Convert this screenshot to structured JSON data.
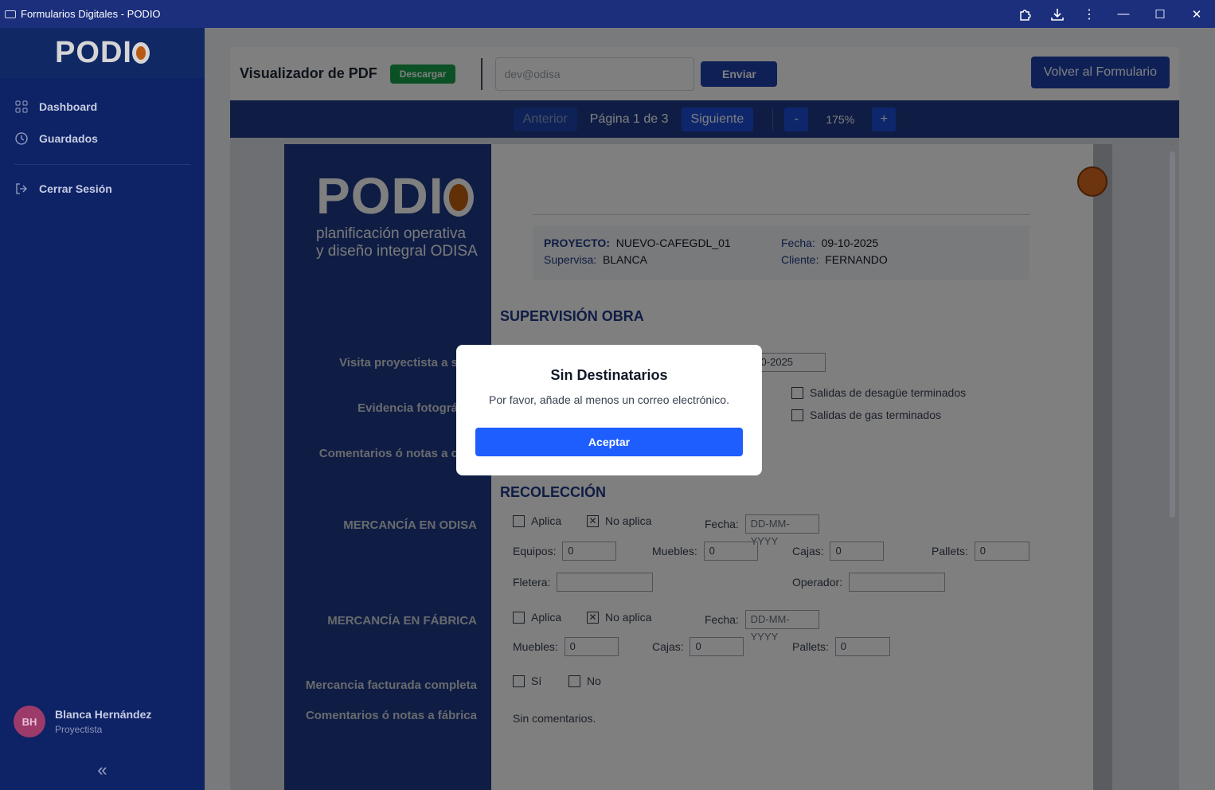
{
  "window": {
    "title": "Formularios Digitales - PODIO"
  },
  "sidebar": {
    "logo": "PODI",
    "items": [
      {
        "label": "Dashboard",
        "icon": "grid-icon"
      },
      {
        "label": "Guardados",
        "icon": "clock-icon"
      }
    ],
    "logout": {
      "label": "Cerrar Sesión",
      "icon": "logout-icon"
    },
    "user": {
      "initials": "BH",
      "name": "Blanca Hernández",
      "role": "Proyectista"
    }
  },
  "toolbar": {
    "title": "Visualizador de PDF",
    "download": "Descargar",
    "email_placeholder": "dev@odisa",
    "send": "Enviar",
    "back": "Volver al Formulario"
  },
  "pager": {
    "prev": "Anterior",
    "label": "Página 1 de 3",
    "next": "Siguiente",
    "zoom_out": "-",
    "zoom": "175%",
    "zoom_in": "+"
  },
  "doc": {
    "logo": "PODI",
    "logo_sub1": "planificación operativa",
    "logo_sub2": "y diseño integral ODISA",
    "info": {
      "proyecto_k": "PROYECTO:",
      "proyecto_v": "NUEVO-CAFEGDL_01",
      "fecha_k": "Fecha:",
      "fecha_v": "09-10-2025",
      "supervisa_k": "Supervisa:",
      "supervisa_v": "BLANCA",
      "cliente_k": "Cliente:",
      "cliente_v": "FERNANDO"
    },
    "sec1": "SUPERVISIÓN OBRA",
    "labels": {
      "visita": "Visita proyectista a s",
      "evidencia": "Evidencia fotográ",
      "comentarios": "Comentarios ó notas a c",
      "merc_odisa": "MERCANCÍA EN ODISA",
      "merc_fabrica": "MERCANCÍA EN FÁBRICA",
      "facturada": "Mercancia facturada completa",
      "com_fabrica": "Comentarios ó notas a fábrica"
    },
    "visita_fecha": "-10-2025",
    "salidas_desague": "Salidas de desagüe terminados",
    "salidas_gas": "Salidas de gas terminados",
    "sec2": "RECOLECCIÓN",
    "aplica": "Aplica",
    "no_aplica": "No aplica",
    "fecha_lbl": "Fecha:",
    "fecha_ph": "DD-MM-YYYY",
    "equipos_lbl": "Equipos:",
    "equipos": "0",
    "muebles_lbl": "Muebles:",
    "muebles": "0",
    "cajas_lbl": "Cajas:",
    "cajas": "0",
    "pallets_lbl": "Pallets:",
    "pallets": "0",
    "fletera_lbl": "Fletera:",
    "operador_lbl": "Operador:",
    "si": "Sí",
    "no": "No",
    "sin_comentarios": "Sin comentarios."
  },
  "modal": {
    "title": "Sin Destinatarios",
    "message": "Por favor, añade al menos un correo electrónico.",
    "accept": "Aceptar"
  }
}
